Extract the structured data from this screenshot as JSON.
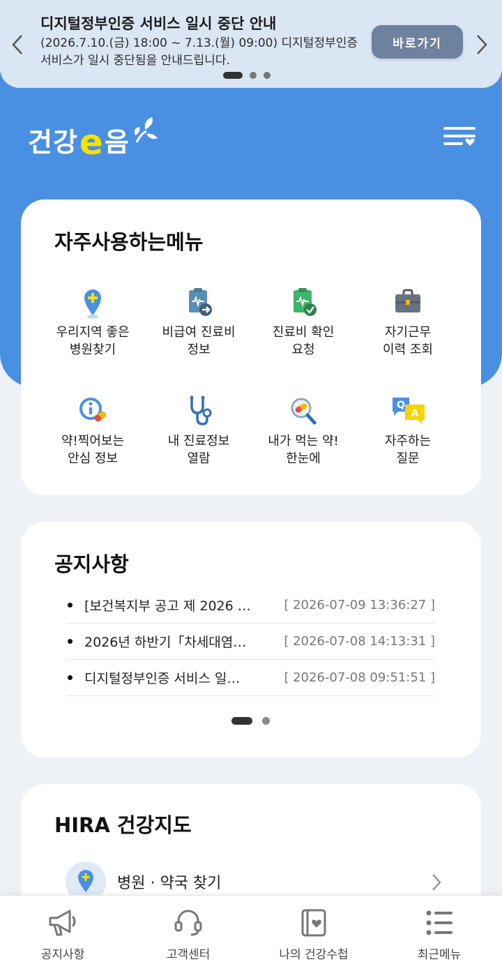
{
  "banner": {
    "title": "디지털정부인증 서비스 일시 중단 안내",
    "body": "(2026.7.10.(금) 18:00 ~ 7.13.(월) 09:00) 디지털정부인증 서비스가 일시 중단됨을 안내드립니다.",
    "button_label": "바로가기",
    "prev_icon": "chevron-left-icon",
    "next_icon": "chevron-right-icon",
    "slide_count": 3,
    "active_slide": 1
  },
  "header": {
    "logo_text_1": "건강",
    "logo_e": "e",
    "logo_text_2": "음",
    "menu_icon": "hamburger-heart-icon"
  },
  "frequent_menu": {
    "title": "자주사용하는메뉴",
    "items": [
      {
        "label": "우리지역 좋은\n병원찾기",
        "icon": "map-pin-plus-icon"
      },
      {
        "label": "비급여 진료비\n정보",
        "icon": "clipboard-arrow-icon"
      },
      {
        "label": "진료비 확인\n요청",
        "icon": "clipboard-check-icon"
      },
      {
        "label": "자기근무\n이력 조회",
        "icon": "briefcase-icon"
      },
      {
        "label": "약!찍어보는\n안심 정보",
        "icon": "info-pill-icon"
      },
      {
        "label": "내 진료정보\n열람",
        "icon": "stethoscope-icon"
      },
      {
        "label": "내가 먹는 약!\n한눈에",
        "icon": "magnifier-pill-icon"
      },
      {
        "label": "자주하는\n질문",
        "icon": "qa-bubble-icon"
      }
    ]
  },
  "notice": {
    "title": "공지사항",
    "items": [
      {
        "title": "[보건복지부 공고 제 2026 …",
        "date": "[ 2026-07-09 13:36:27 ]"
      },
      {
        "title": "2026년 하반기「차세대염…",
        "date": "[ 2026-07-08 14:13:31 ]"
      },
      {
        "title": "디지털정부인증 서비스 일…",
        "date": "[ 2026-07-08 09:51:51 ]"
      }
    ],
    "page_count": 2,
    "active_page": 1
  },
  "health_map": {
    "title": "HIRA 건강지도",
    "row_label": "병원 · 약국 찾기",
    "row_icon": "map-pin-plus-icon"
  },
  "bottom_nav": {
    "items": [
      {
        "label": "공지사항",
        "icon": "megaphone-icon"
      },
      {
        "label": "고객센터",
        "icon": "headset-icon"
      },
      {
        "label": "나의 건강수첩",
        "icon": "health-book-icon"
      },
      {
        "label": "최근메뉴",
        "icon": "list-icon"
      }
    ]
  },
  "colors": {
    "brand_blue": "#4a90e2",
    "banner_bg": "#dbe6f4",
    "banner_button": "#6e819e",
    "logo_yellow": "#f5e400"
  }
}
